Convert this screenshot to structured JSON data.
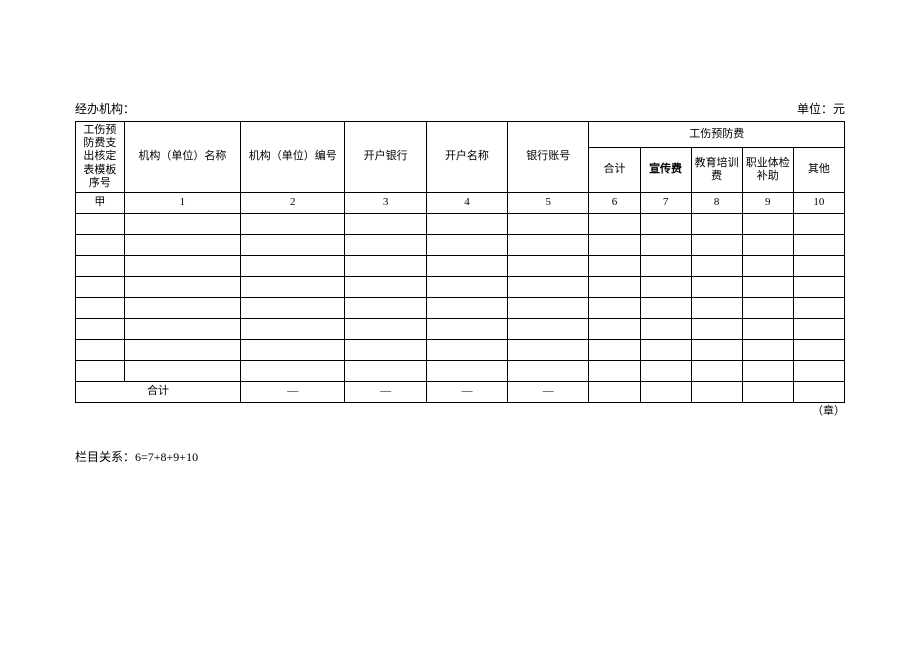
{
  "header": {
    "left_label": "经办机构：",
    "right_label": "单位：元"
  },
  "columns": {
    "seq": "工伤预防费支出核定表模板序号",
    "org_name": "机构（单位）名称",
    "org_code": "机构（单位）编号",
    "bank": "开户银行",
    "acct_name": "开户名称",
    "acct_no": "银行账号",
    "group": "工伤预防费",
    "sub_total": "合计",
    "sub_pub": "宣传费",
    "sub_edu": "教育培训费",
    "sub_med": "职业体检补助",
    "sub_other": "其他"
  },
  "index_row": {
    "seq": "甲",
    "c1": "1",
    "c2": "2",
    "c3": "3",
    "c4": "4",
    "c5": "5",
    "c6": "6",
    "c7": "7",
    "c8": "8",
    "c9": "9",
    "c10": "10"
  },
  "rows": [
    {
      "seq": "",
      "org_name": "",
      "org_code": "",
      "bank": "",
      "acct_name": "",
      "acct_no": "",
      "t": "",
      "p": "",
      "e": "",
      "m": "",
      "o": ""
    },
    {
      "seq": "",
      "org_name": "",
      "org_code": "",
      "bank": "",
      "acct_name": "",
      "acct_no": "",
      "t": "",
      "p": "",
      "e": "",
      "m": "",
      "o": ""
    },
    {
      "seq": "",
      "org_name": "",
      "org_code": "",
      "bank": "",
      "acct_name": "",
      "acct_no": "",
      "t": "",
      "p": "",
      "e": "",
      "m": "",
      "o": ""
    },
    {
      "seq": "",
      "org_name": "",
      "org_code": "",
      "bank": "",
      "acct_name": "",
      "acct_no": "",
      "t": "",
      "p": "",
      "e": "",
      "m": "",
      "o": ""
    },
    {
      "seq": "",
      "org_name": "",
      "org_code": "",
      "bank": "",
      "acct_name": "",
      "acct_no": "",
      "t": "",
      "p": "",
      "e": "",
      "m": "",
      "o": ""
    },
    {
      "seq": "",
      "org_name": "",
      "org_code": "",
      "bank": "",
      "acct_name": "",
      "acct_no": "",
      "t": "",
      "p": "",
      "e": "",
      "m": "",
      "o": ""
    },
    {
      "seq": "",
      "org_name": "",
      "org_code": "",
      "bank": "",
      "acct_name": "",
      "acct_no": "",
      "t": "",
      "p": "",
      "e": "",
      "m": "",
      "o": ""
    },
    {
      "seq": "",
      "org_name": "",
      "org_code": "",
      "bank": "",
      "acct_name": "",
      "acct_no": "",
      "t": "",
      "p": "",
      "e": "",
      "m": "",
      "o": ""
    }
  ],
  "total_row": {
    "label": "合计",
    "org_code": "—",
    "bank": "—",
    "acct_name": "—",
    "acct_no": "—",
    "t": "",
    "p": "",
    "e": "",
    "m": "",
    "o": ""
  },
  "stamp": "（章）",
  "footnote": "栏目关系：6=7+8+9+10"
}
